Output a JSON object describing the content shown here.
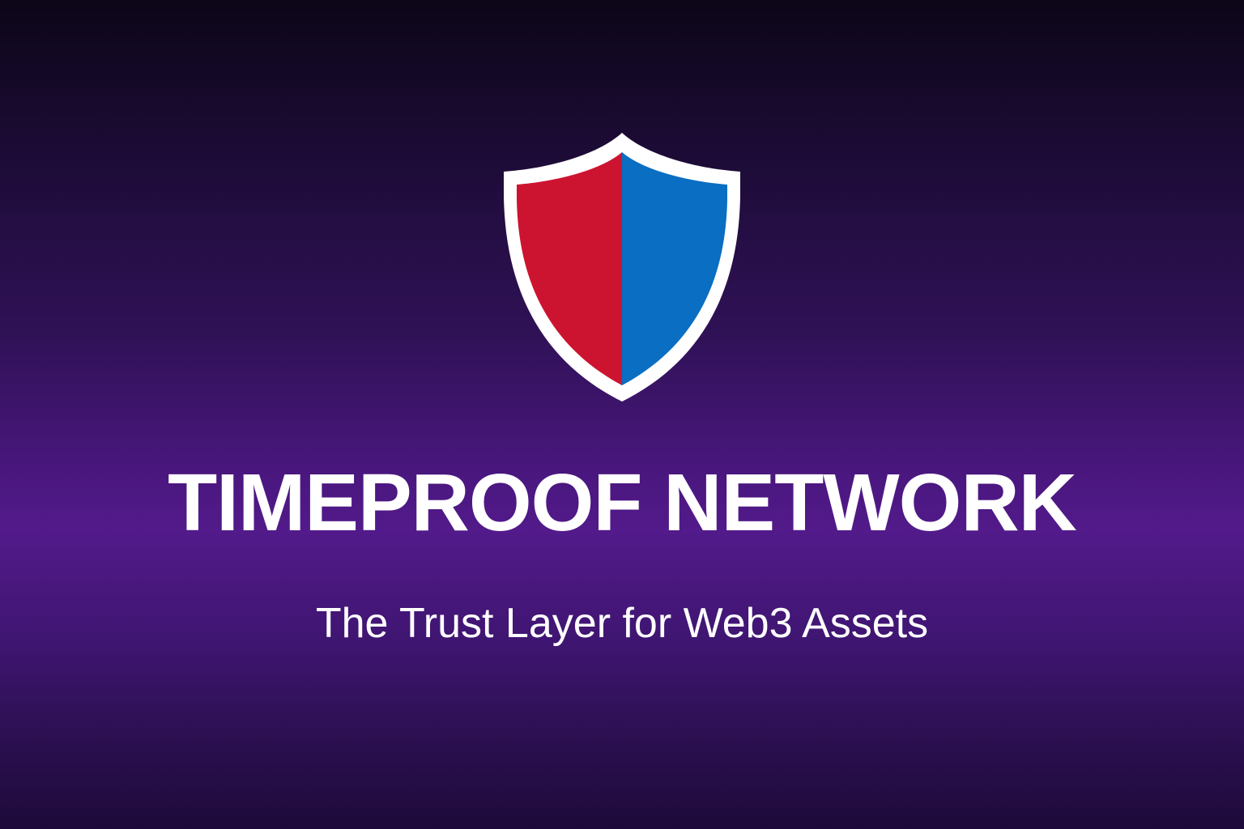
{
  "brand": {
    "name": "TIMEPROOF NETWORK",
    "tagline": "The Trust Layer for Web3 Assets"
  },
  "logo": {
    "icon": "shield-icon",
    "left_color": "#cc1431",
    "right_color": "#0a6ec2",
    "outline_color": "#ffffff"
  },
  "background": {
    "top_color": "#0c0618",
    "mid_color": "#521a8a",
    "bottom_color": "#1e0a3a"
  }
}
